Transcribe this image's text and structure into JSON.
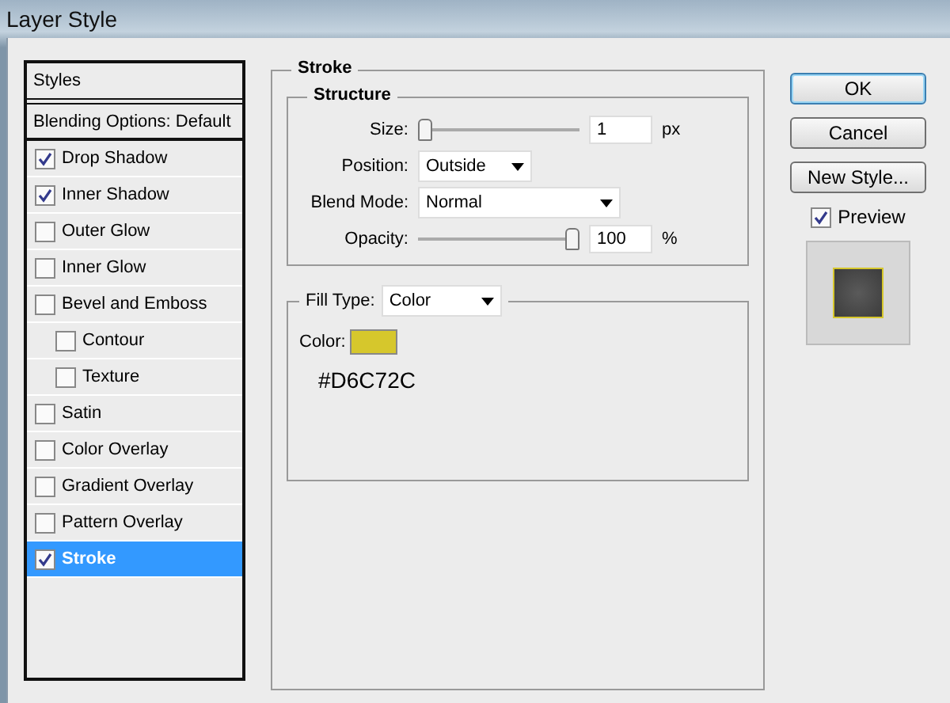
{
  "window": {
    "title": "Layer Style"
  },
  "sidebar": {
    "header": "Styles",
    "items": [
      {
        "label": "Blending Options: Default",
        "kind": "option",
        "selected": false
      },
      {
        "label": "Drop Shadow",
        "kind": "effect",
        "checked": true,
        "selected": false
      },
      {
        "label": "Inner Shadow",
        "kind": "effect",
        "checked": true,
        "selected": false
      },
      {
        "label": "Outer Glow",
        "kind": "effect",
        "checked": false,
        "selected": false
      },
      {
        "label": "Inner Glow",
        "kind": "effect",
        "checked": false,
        "selected": false
      },
      {
        "label": "Bevel and Emboss",
        "kind": "effect",
        "checked": false,
        "selected": false,
        "children": [
          {
            "label": "Contour",
            "kind": "effect",
            "checked": false,
            "selected": false
          },
          {
            "label": "Texture",
            "kind": "effect",
            "checked": false,
            "selected": false
          }
        ]
      },
      {
        "label": "Satin",
        "kind": "effect",
        "checked": false,
        "selected": false
      },
      {
        "label": "Color Overlay",
        "kind": "effect",
        "checked": false,
        "selected": false
      },
      {
        "label": "Gradient Overlay",
        "kind": "effect",
        "checked": false,
        "selected": false
      },
      {
        "label": "Pattern Overlay",
        "kind": "effect",
        "checked": false,
        "selected": false
      },
      {
        "label": "Stroke",
        "kind": "effect",
        "checked": true,
        "selected": true
      }
    ]
  },
  "stroke": {
    "title": "Stroke",
    "structure": {
      "title": "Structure",
      "size": {
        "label": "Size:",
        "level": 0,
        "value": "1",
        "unit": "px"
      },
      "position": {
        "label": "Position:",
        "value": "Outside"
      },
      "blend_mode": {
        "label": "Blend Mode:",
        "value": "Normal"
      },
      "opacity": {
        "label": "Opacity:",
        "level": 1,
        "value": "100",
        "unit": "%"
      }
    },
    "fill": {
      "label": "Fill Type:",
      "value": "Color",
      "color_label": "Color:",
      "color": "#d6c72c",
      "hex": "#D6C72C"
    }
  },
  "buttons": [
    {
      "label": "OK",
      "default": true
    },
    {
      "label": "Cancel",
      "default": false
    },
    {
      "label": "New Style...",
      "default": false
    }
  ],
  "preview": {
    "label": "Preview",
    "checked": true
  }
}
